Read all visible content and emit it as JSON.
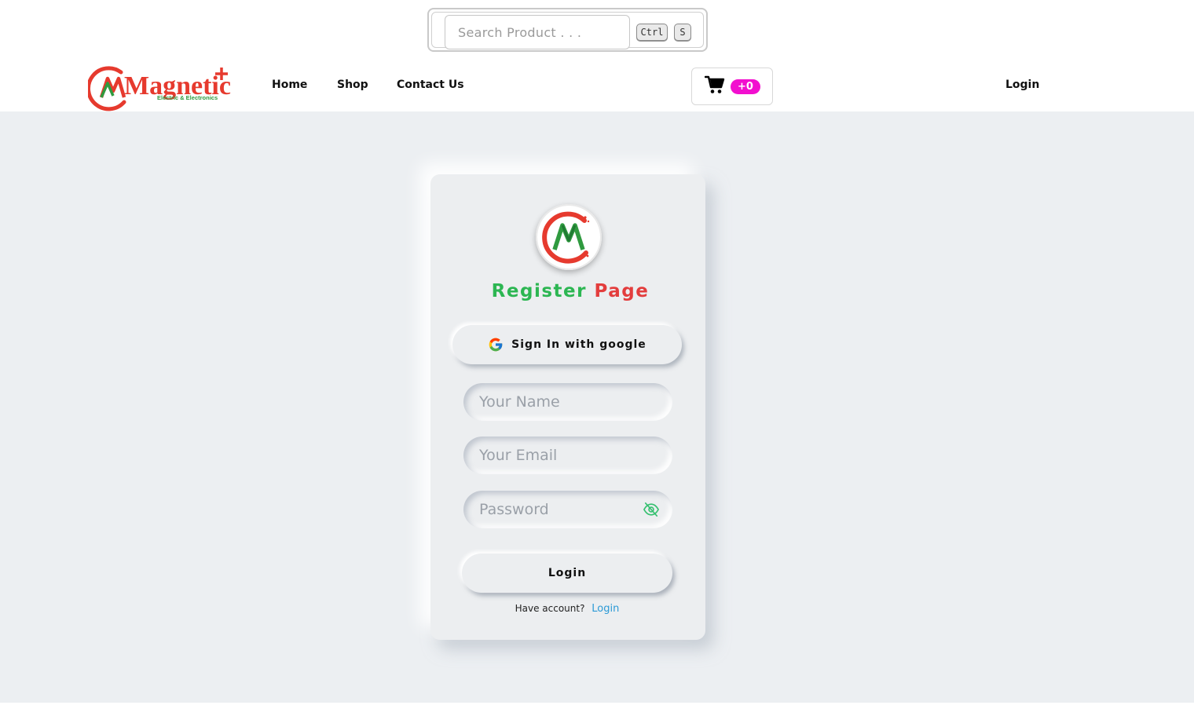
{
  "header": {
    "search": {
      "placeholder": "Search Product . . .",
      "shortcut_keys": [
        "Ctrl",
        "S"
      ]
    },
    "logo": {
      "brand": "Magnetic",
      "tagline": "Electric & Electronics"
    },
    "nav": [
      "Home",
      "Shop",
      "Contact Us"
    ],
    "cart": {
      "icon": "cart-icon",
      "count_label": "+0"
    },
    "login_label": "Login"
  },
  "register_card": {
    "title_part1": "Register",
    "title_part2": "Page",
    "google_button_label": "Sign In with google",
    "fields": {
      "name_placeholder": "Your Name",
      "email_placeholder": "Your Email",
      "password_placeholder": "Password"
    },
    "submit_label": "Login",
    "have_account_text": "Have account?",
    "login_link_label": "Login"
  },
  "colors": {
    "brand_green": "#2cb652",
    "brand_red": "#e33d3d",
    "badge_magenta": "#f20fcf",
    "link_blue": "#2b9ad6",
    "page_bg": "#eceff2"
  }
}
